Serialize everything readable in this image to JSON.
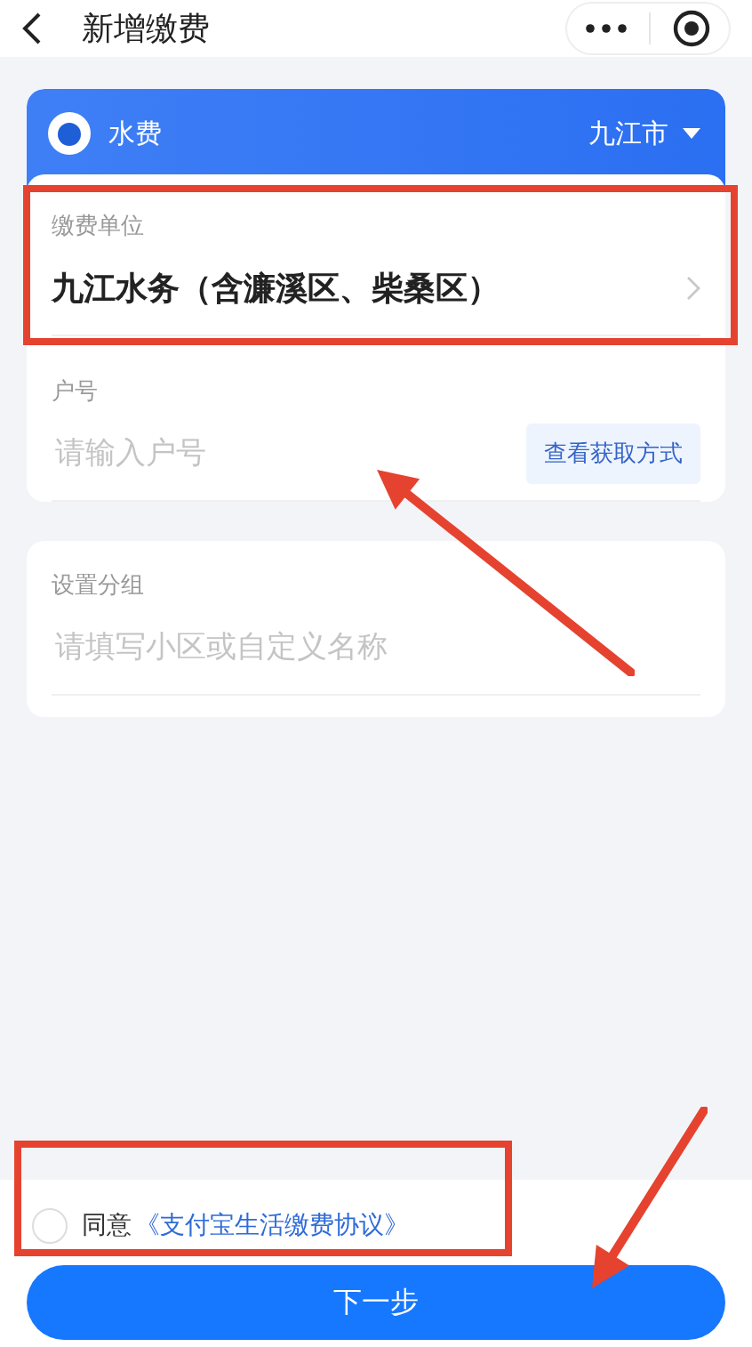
{
  "header": {
    "title": "新增缴费"
  },
  "category": {
    "name": "水费",
    "city": "九江市"
  },
  "fields": [
    {
      "kind": "select",
      "label": "缴费单位",
      "value": "九江水务（含濂溪区、柴桑区）"
    },
    {
      "kind": "input",
      "label": "户号",
      "placeholder": "请输入户号",
      "action": "查看获取方式"
    }
  ],
  "group_field": {
    "label": "设置分组",
    "placeholder": "请填写小区或自定义名称"
  },
  "agreement": {
    "checked": false,
    "prefix": "同意",
    "link": "《支付宝生活缴费协议》"
  },
  "next_button": {
    "label": "下一步"
  }
}
